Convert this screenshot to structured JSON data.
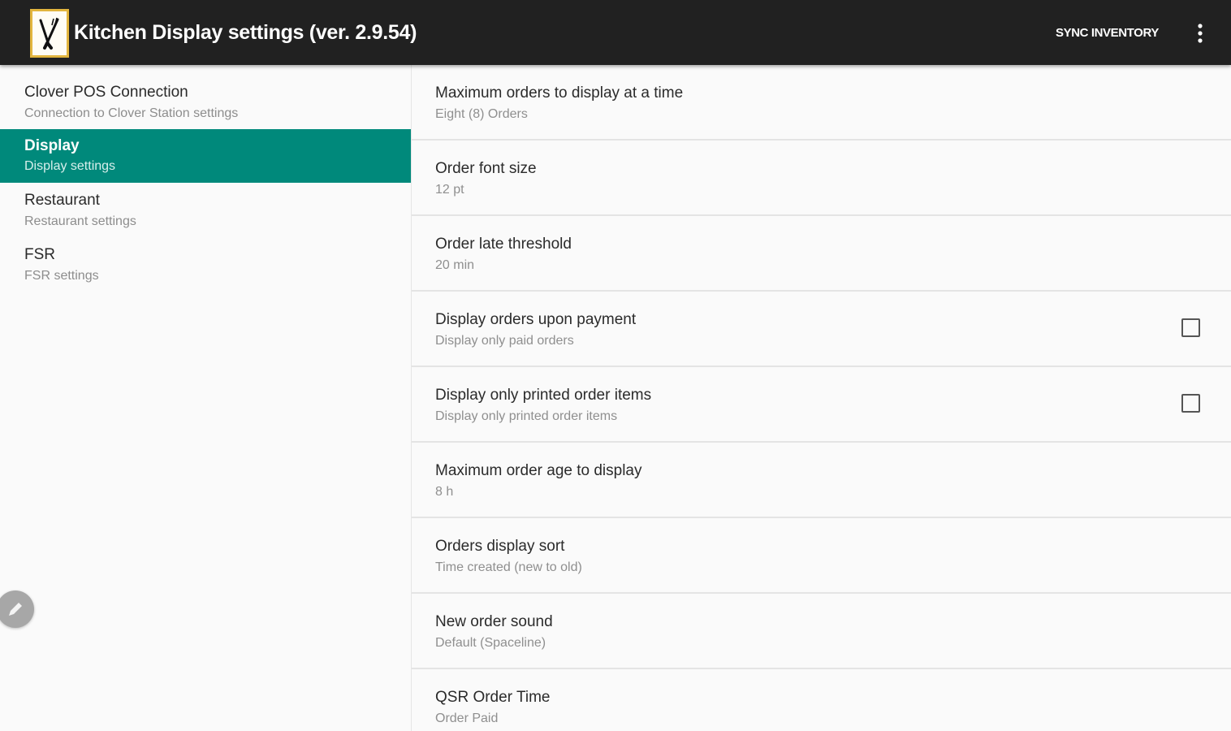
{
  "appbar": {
    "title": "Kitchen Display settings (ver. 2.9.54)",
    "sync_label": "SYNC INVENTORY",
    "logo_icon": "kitchen-utensils-logo-icon",
    "overflow_icon": "more-vert-icon"
  },
  "sidebar": {
    "items": [
      {
        "title": "Clover POS Connection",
        "subtitle": "Connection to Clover Station settings",
        "active": false
      },
      {
        "title": "Display",
        "subtitle": "Display settings",
        "active": true
      },
      {
        "title": "Restaurant",
        "subtitle": "Restaurant settings",
        "active": false
      },
      {
        "title": "FSR",
        "subtitle": "FSR settings",
        "active": false
      }
    ]
  },
  "fab": {
    "icon": "pencil-edit-icon"
  },
  "preferences": [
    {
      "title": "Maximum orders to display at a time",
      "summary": "Eight (8) Orders"
    },
    {
      "title": "Order font size",
      "summary": "12 pt"
    },
    {
      "title": "Order late threshold",
      "summary": "20 min"
    },
    {
      "title": "Display orders upon payment",
      "summary": "Display only paid orders",
      "checked": false
    },
    {
      "title": "Display only printed order items",
      "summary": "Display only printed order items",
      "checked": false
    },
    {
      "title": "Maximum order age to display",
      "summary": "8 h"
    },
    {
      "title": "Orders display sort",
      "summary": "Time created (new to old)"
    },
    {
      "title": "New order sound",
      "summary": "Default (Spaceline)"
    },
    {
      "title": "QSR Order Time",
      "summary": "Order Paid"
    }
  ],
  "colors": {
    "appbar_bg": "#212121",
    "accent": "#00897b",
    "logo_border": "#e2b53e",
    "background": "#fafafa",
    "divider": "#e4e4e4"
  }
}
